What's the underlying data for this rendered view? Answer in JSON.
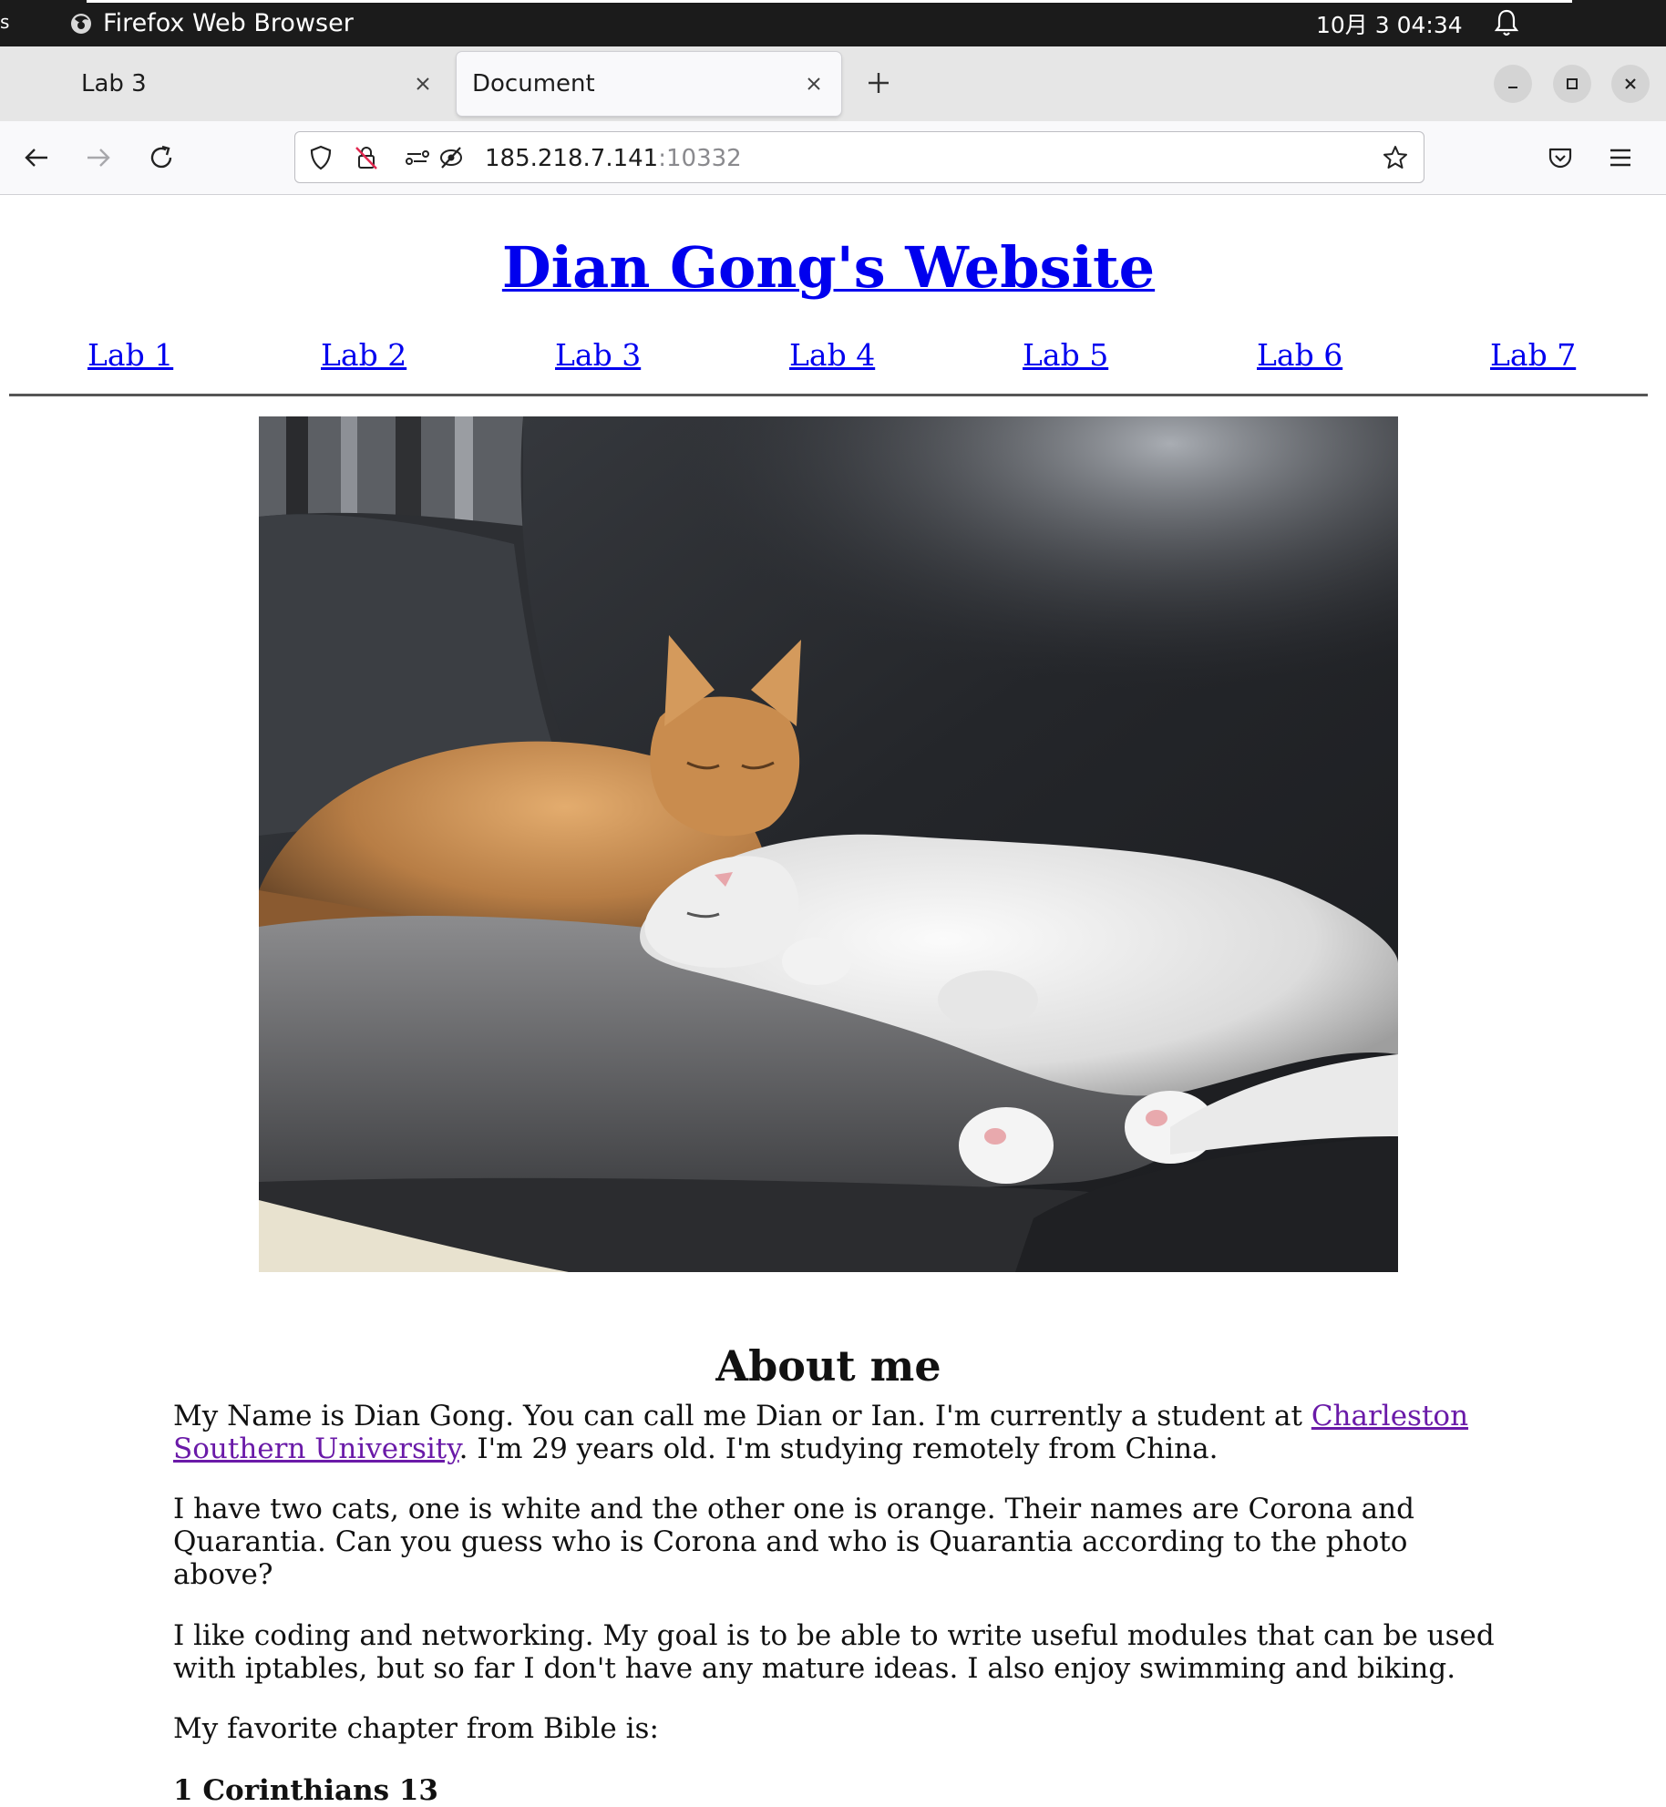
{
  "system_bar": {
    "app_name": "Firefox Web Browser",
    "clock": "10月 3  04:34"
  },
  "browser": {
    "tabs": [
      {
        "label": "Lab 3",
        "active": false
      },
      {
        "label": "Document",
        "active": true
      }
    ],
    "url_host": "185.218.7.141",
    "url_port": ":10332"
  },
  "page": {
    "title": "Dian Gong's Website",
    "nav": [
      "Lab 1",
      "Lab 2",
      "Lab 3",
      "Lab 4",
      "Lab 5",
      "Lab 6",
      "Lab 7"
    ],
    "about_heading": "About me",
    "p1_before": "My Name is Dian Gong. You can call me Dian or Ian. I'm currently a student at ",
    "p1_link": "Charleston Southern University",
    "p1_after": ". I'm 29 years old. I'm studying remotely from China.",
    "p2": "I have two cats, one is white and the other one is orange. Their names are Corona and Quarantia. Can you guess who is Corona and who is Quarantia according to the photo above?",
    "p3": "I like coding and networking. My goal is to be able to write useful modules that can be used with iptables, but so far I don't have any mature ideas. I also enjoy swimming and biking.",
    "p4": "My favorite chapter from Bible is:",
    "p5": "1 Corinthians 13"
  },
  "icons": {
    "firefox": "firefox-icon",
    "bell": "bell-icon",
    "close": "close-icon",
    "new_tab": "plus-icon",
    "back": "back-arrow-icon",
    "forward": "forward-arrow-icon",
    "reload": "reload-icon",
    "shield": "tracking-protection-shield-icon",
    "insecure": "insecure-connection-icon",
    "permissions": "permissions-icon",
    "star": "bookmark-star-icon",
    "pocket": "pocket-icon",
    "menu": "hamburger-menu-icon"
  },
  "colors": {
    "link": "#0000ee",
    "visited_link": "#6a1aa8",
    "topbar": "#1b1b1b",
    "tabstrip": "#e6e6e6"
  }
}
